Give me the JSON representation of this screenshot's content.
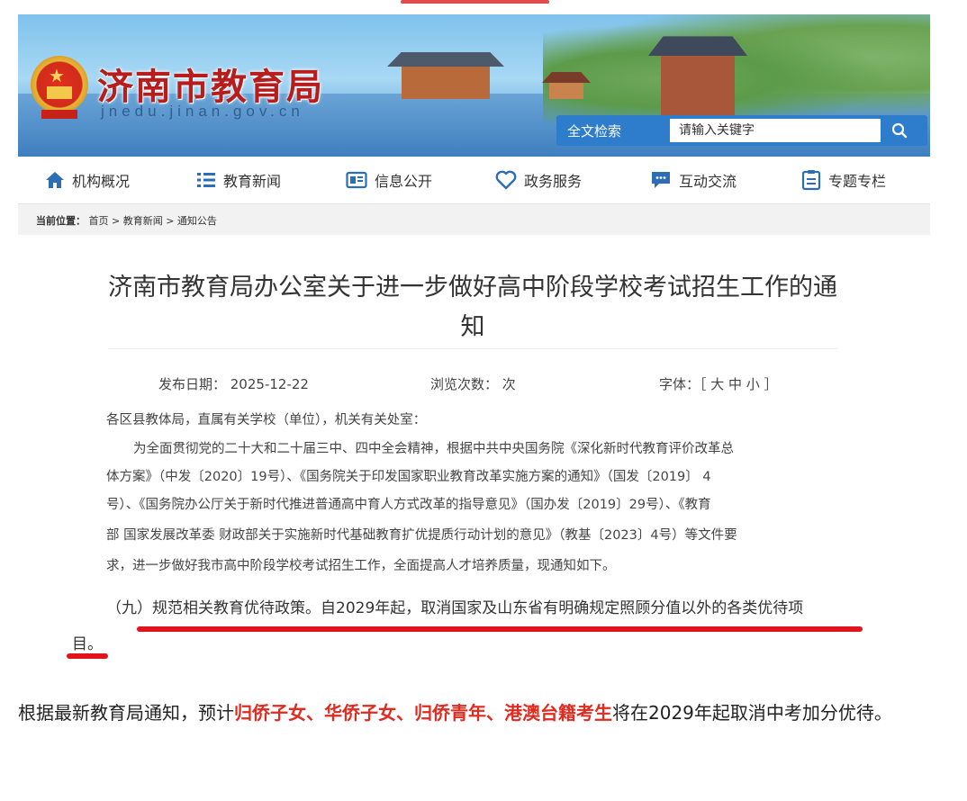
{
  "header": {
    "site_title": "济南市教育局",
    "site_domain": "jnedu.jinan.gov.cn",
    "search_label": "全文检索",
    "search_placeholder": "请输入关键字"
  },
  "nav": {
    "items": [
      {
        "label": "机构概况",
        "icon": "home-icon"
      },
      {
        "label": "教育新闻",
        "icon": "list-icon"
      },
      {
        "label": "信息公开",
        "icon": "document-icon"
      },
      {
        "label": "政务服务",
        "icon": "heart-icon"
      },
      {
        "label": "互动交流",
        "icon": "chat-icon"
      },
      {
        "label": "专题专栏",
        "icon": "clipboard-icon"
      }
    ]
  },
  "breadcrumb": {
    "prefix": "当前位置：",
    "path": "首页 > 教育新闻 > 通知公告"
  },
  "article": {
    "title_line1": "济南市教育局办公室关于进一步做好高中阶段学校考试招生工作的通",
    "title_line2": "知",
    "publish_date": "发布日期：  2025-12-22",
    "views": "浏览次数：  次",
    "font_size": "字体：［ 大 中 小 ］",
    "salutation": "各区县教体局，直属有关学校（单位），机关有关处室：",
    "body_lines": [
      "为全面贯彻党的二十大和二十届三中、四中全会精神，根据中共中央国务院《深化新时代教育评价改革总",
      "体方案》（中发〔2020〕19号）、《国务院关于印发国家职业教育改革实施方案的通知》（国发〔2019〕 4",
      "号）、《国务院办公厅关于新时代推进普通高中育人方式改革的指导意见》（国办发〔2019〕29号）、《教育",
      "部  国家发展改革委  财政部关于实施新时代基础教育扩优提质行动计划的意见》（教基〔2023〕4号）等文件要",
      "求，进一步做好我市高中阶段学校考试招生工作，全面提高人才培养质量，现通知如下。"
    ],
    "highlight_line1": "（九）规范相关教育优待政策。自2029年起，取消国家及山东省有明确规定照顾分值以外的各类优待项",
    "highlight_line2": "目。"
  },
  "caption": {
    "pre": "根据最新教育局通知，预计",
    "red": "归侨子女、华侨子女、归侨青年、港澳台籍考生",
    "post": "将在2029年起取消中考加分优待。"
  },
  "colors": {
    "brand_red": "#b81d1d",
    "search_blue": "#2e7ccc",
    "nav_icon_blue": "#2d6db5",
    "annotation_red": "#e0141a",
    "caption_red": "#e02b20"
  }
}
